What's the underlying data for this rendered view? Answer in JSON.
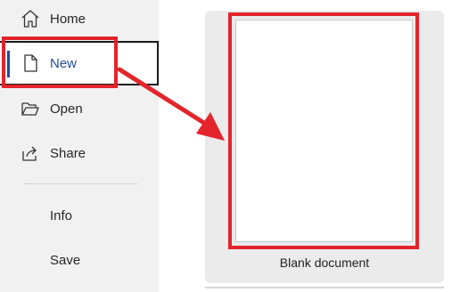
{
  "sidebar": {
    "items": [
      {
        "label": "Home",
        "icon": "home-icon"
      },
      {
        "label": "New",
        "icon": "new-document-icon"
      },
      {
        "label": "Open",
        "icon": "folder-open-icon"
      },
      {
        "label": "Share",
        "icon": "share-icon"
      },
      {
        "label": "Info"
      },
      {
        "label": "Save"
      }
    ],
    "selected": "New"
  },
  "templates": [
    {
      "label": "Blank document"
    }
  ],
  "colors": {
    "accent": "#1f4e9c",
    "highlight": "#e3242b",
    "sidebar_bg": "#f1f1f1",
    "card_bg": "#ebebeb"
  }
}
